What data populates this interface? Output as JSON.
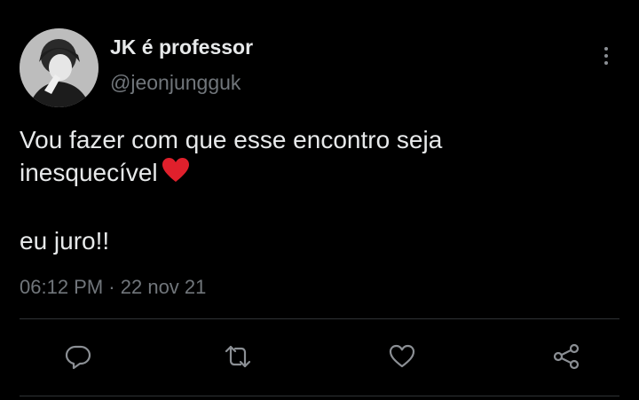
{
  "tweet": {
    "display_name": "JK é professor",
    "handle": "@jeonjungguk",
    "text_line1": "Vou fazer com que esse encontro seja",
    "text_line2": "inesquecível",
    "text_line3": "eu juro!!",
    "emoji": "red-heart-emoji",
    "time": "06:12 PM",
    "separator": "·",
    "date": "22 nov 21"
  },
  "actions": {
    "reply": "reply-icon",
    "retweet": "retweet-icon",
    "like": "heart-icon",
    "share": "share-icon"
  },
  "colors": {
    "background": "#000000",
    "text": "#e7e9ea",
    "secondary": "#71767b",
    "heart": "#e0202c",
    "divider": "#2f3336"
  }
}
